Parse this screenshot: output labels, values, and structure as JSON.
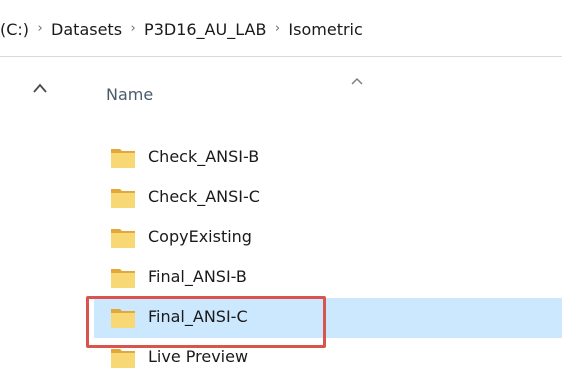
{
  "breadcrumb": {
    "items": [
      "(C:)",
      "Datasets",
      "P3D16_AU_LAB",
      "Isometric"
    ],
    "separator": "›"
  },
  "header": {
    "name_column": "Name",
    "sort_indicator": "sort-ascending-caret"
  },
  "files": [
    {
      "name": "Check_ANSI-B",
      "icon": "folder-icon",
      "selected": false
    },
    {
      "name": "Check_ANSI-C",
      "icon": "folder-icon",
      "selected": false
    },
    {
      "name": "CopyExisting",
      "icon": "folder-icon",
      "selected": false
    },
    {
      "name": "Final_ANSI-B",
      "icon": "folder-icon",
      "selected": false
    },
    {
      "name": "Final_ANSI-C",
      "icon": "folder-icon",
      "selected": true
    },
    {
      "name": "Live Preview",
      "icon": "folder-icon",
      "selected": false
    }
  ],
  "colors": {
    "selection": "#cce8ff",
    "highlight_box": "#d9534f",
    "folder_body": "#f8d775",
    "folder_tab": "#e0a93a"
  }
}
